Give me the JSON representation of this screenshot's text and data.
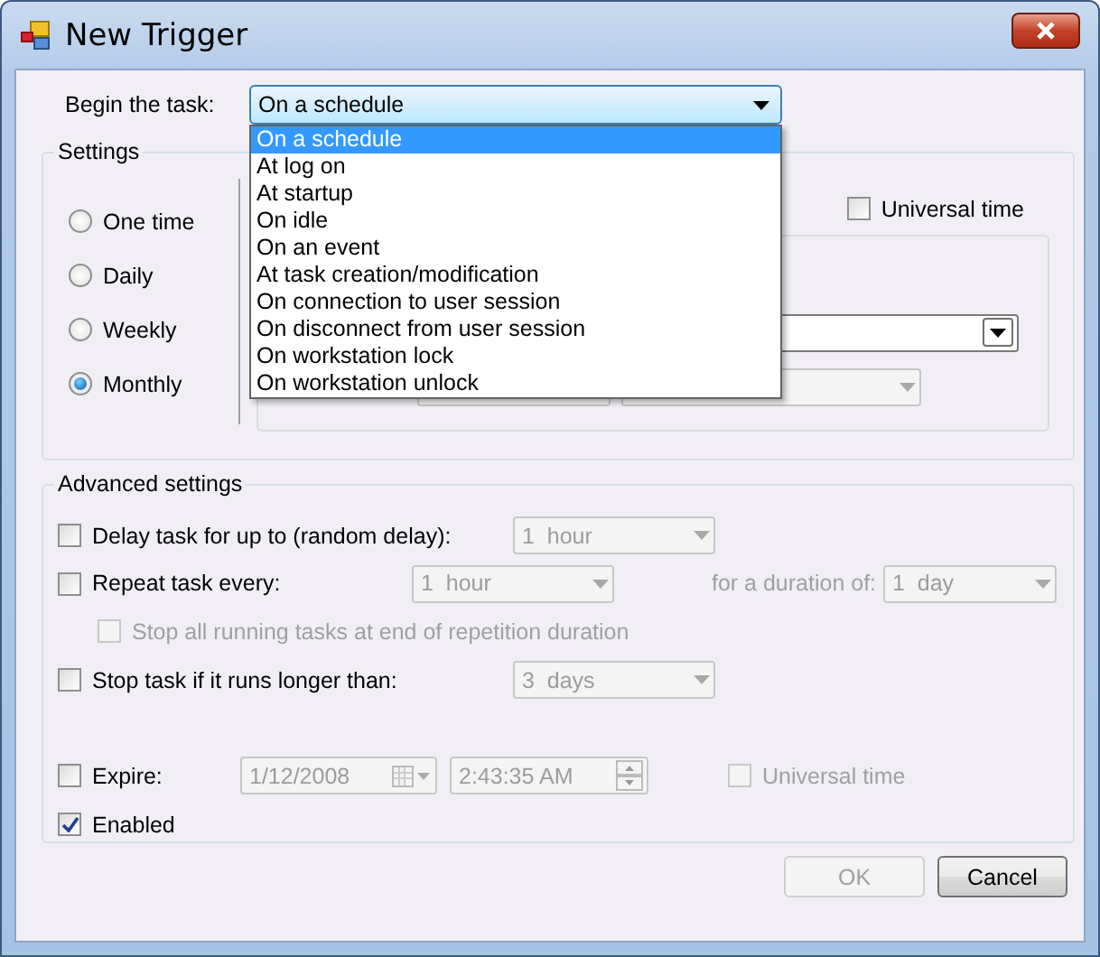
{
  "window": {
    "title": "New Trigger"
  },
  "begin": {
    "label": "Begin the task:",
    "value": "On a schedule",
    "options": [
      {
        "label": "On a schedule",
        "selected": true
      },
      {
        "label": "At log on",
        "selected": false
      },
      {
        "label": "At startup",
        "selected": false
      },
      {
        "label": "On idle",
        "selected": false
      },
      {
        "label": "On an event",
        "selected": false
      },
      {
        "label": "At task creation/modification",
        "selected": false
      },
      {
        "label": "On connection to user session",
        "selected": false
      },
      {
        "label": "On disconnect from user session",
        "selected": false
      },
      {
        "label": "On workstation lock",
        "selected": false
      },
      {
        "label": "On workstation unlock",
        "selected": false
      }
    ]
  },
  "settings": {
    "title": "Settings",
    "universal_time": {
      "label": "Universal time",
      "checked": false
    },
    "schedule": [
      {
        "label": "One time",
        "selected": false
      },
      {
        "label": "Daily",
        "selected": false
      },
      {
        "label": "Weekly",
        "selected": false
      },
      {
        "label": "Monthly",
        "selected": true
      }
    ]
  },
  "advanced": {
    "title": "Advanced settings",
    "rows": [
      {
        "kind": "option",
        "label": "Delay task for up to (random delay):",
        "checked": false,
        "value": "1  hour"
      },
      {
        "kind": "repeat",
        "label": "Repeat task every:",
        "checked": false,
        "value": "1  hour",
        "duration_label": "for a duration of:",
        "duration_value": "1  day"
      },
      {
        "kind": "sub",
        "label": "Stop all running tasks at end of repetition duration",
        "checked": false
      },
      {
        "kind": "option",
        "label": "Stop task if it runs longer than:",
        "checked": false,
        "value": "3  days"
      },
      {
        "kind": "expire",
        "label": "Expire:",
        "checked": false,
        "date": "1/12/2008",
        "time": "2:43:35 AM",
        "utc_label": "Universal time",
        "utc_checked": false
      },
      {
        "kind": "plain",
        "label": "Enabled",
        "checked": true
      }
    ]
  },
  "buttons": [
    {
      "label": "OK",
      "disabled": true
    },
    {
      "label": "Cancel",
      "disabled": false
    }
  ]
}
